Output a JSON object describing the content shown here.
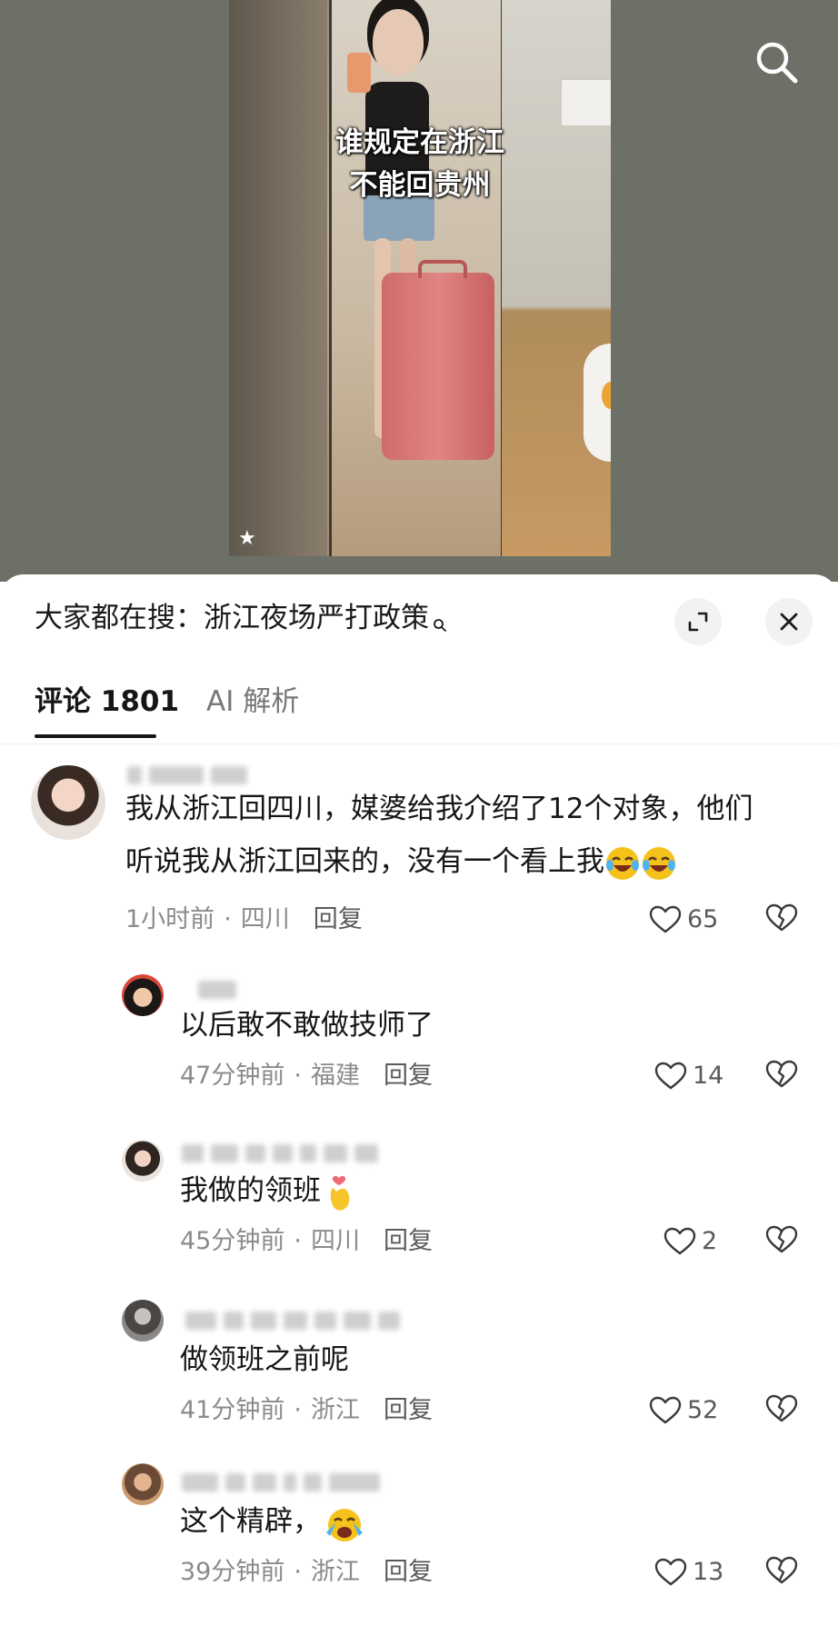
{
  "video": {
    "caption_line1": "谁规定在浙江",
    "caption_line2": "不能回贵州"
  },
  "panel": {
    "trending_prefix": "大家都在搜：",
    "trending_query": "浙江夜场严打政策",
    "tabs": [
      {
        "label": "评论 1801",
        "active": true
      },
      {
        "label": "AI 解析",
        "active": false
      }
    ]
  },
  "comments": [
    {
      "level": "top",
      "text_line1": "我从浙江回四川，媒婆给我介绍了12个对象，他们",
      "text_line2": "听说我从浙江回来的，没有一个看上我",
      "emoji": [
        "crying-laughing-emoji",
        "crying-laughing-emoji"
      ],
      "time": "1小时前",
      "location": "四川",
      "reply_label": "回复",
      "likes": "65"
    },
    {
      "level": "reply",
      "text": "以后敢不敢做技师了",
      "time": "47分钟前",
      "location": "福建",
      "reply_label": "回复",
      "likes": "14"
    },
    {
      "level": "reply",
      "text": "我做的领班",
      "emoji": [
        "finger-heart-emoji"
      ],
      "time": "45分钟前",
      "location": "四川",
      "reply_label": "回复",
      "likes": "2"
    },
    {
      "level": "reply",
      "text": "做领班之前呢",
      "time": "41分钟前",
      "location": "浙江",
      "reply_label": "回复",
      "likes": "52"
    },
    {
      "level": "reply",
      "text": "这个精辟，",
      "emoji": [
        "loudly-crying-emoji"
      ],
      "time": "39分钟前",
      "location": "浙江",
      "reply_label": "回复",
      "likes": "13"
    }
  ],
  "colors": {
    "video_background": "#6c7066",
    "panel_background": "#ffffff",
    "text_primary": "#161616",
    "text_secondary": "#8b8b8b",
    "tab_inactive": "#777777"
  }
}
